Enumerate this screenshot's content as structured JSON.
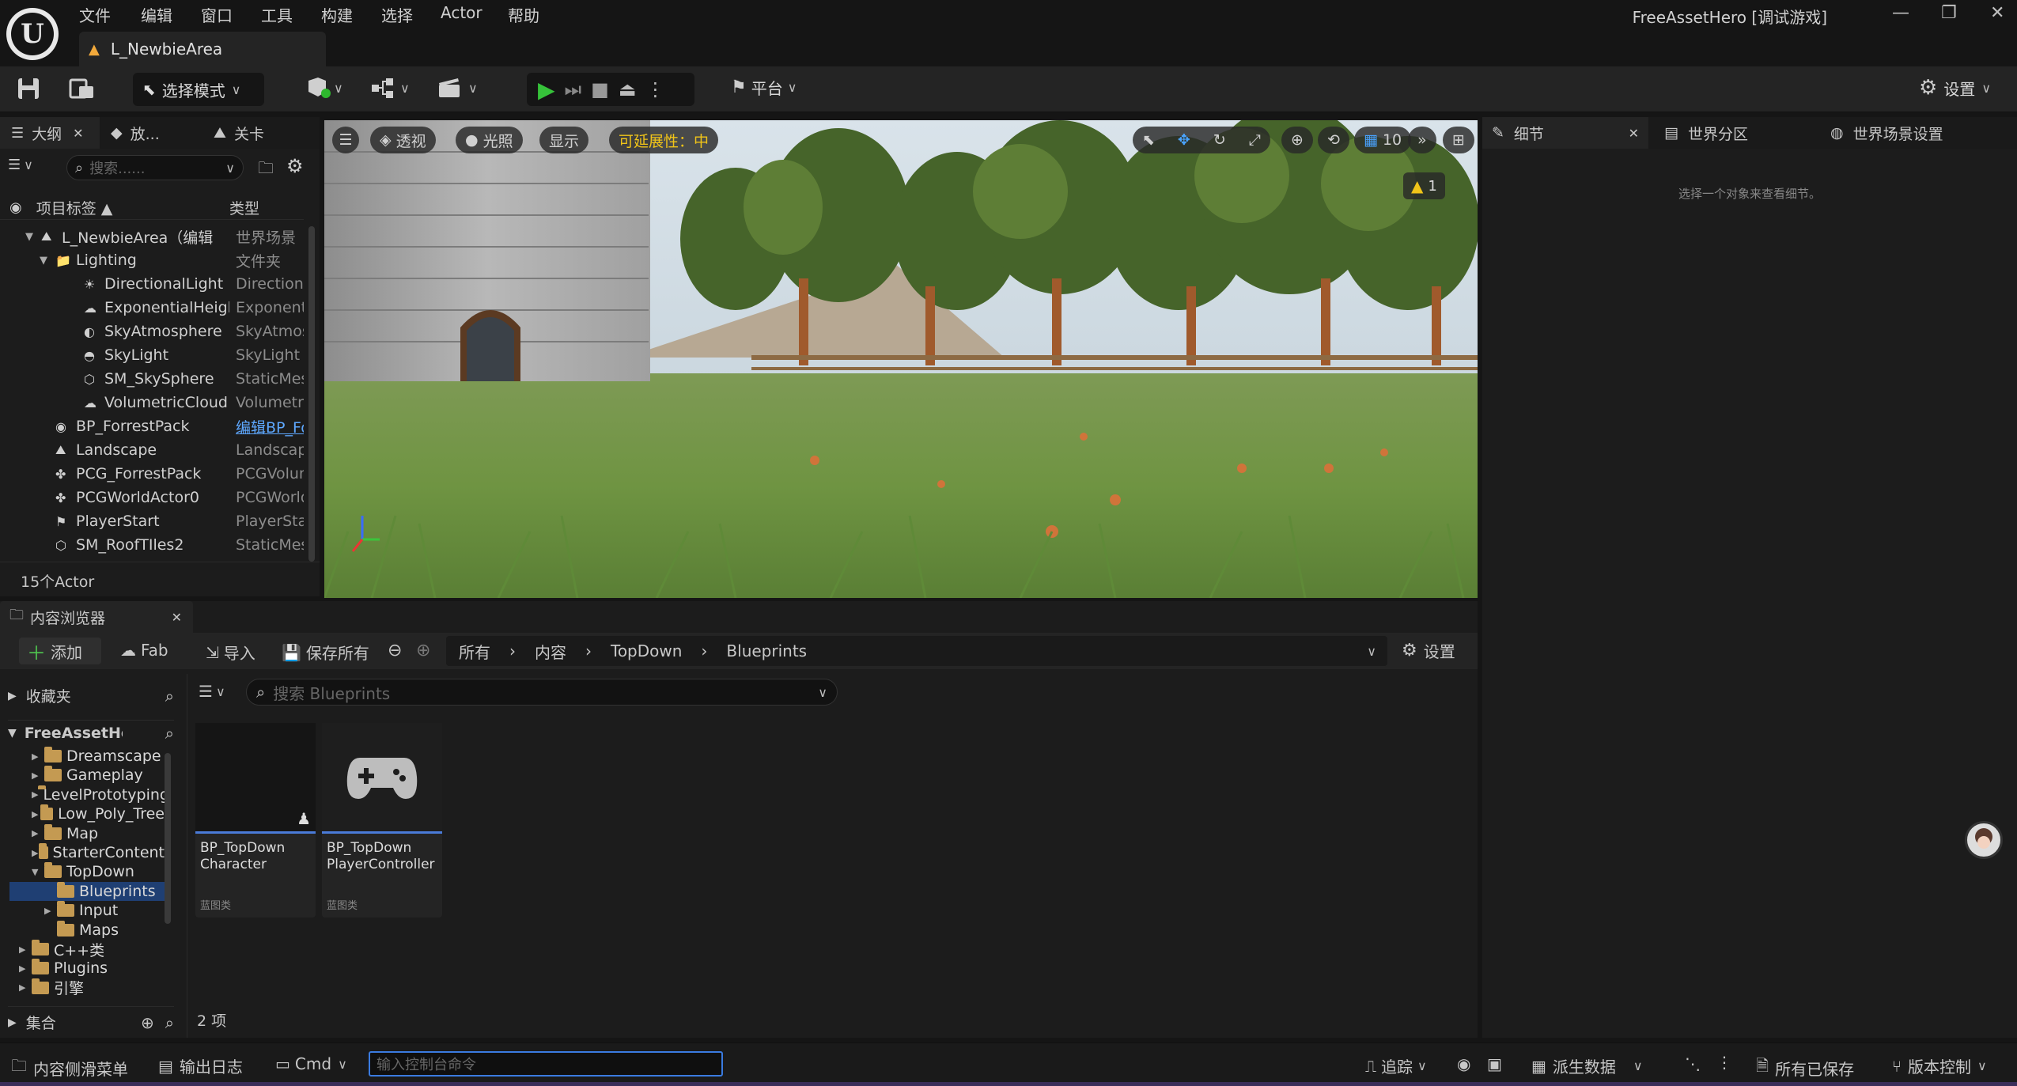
{
  "app": {
    "title": "FreeAssetHero [调试游戏]",
    "level_tab": "L_NewbieArea",
    "menu": [
      "文件",
      "编辑",
      "窗口",
      "工具",
      "构建",
      "选择",
      "Actor",
      "帮助"
    ]
  },
  "toolbar": {
    "select_mode": "选择模式",
    "platform": "平台",
    "settings": "设置"
  },
  "outliner": {
    "tabs": [
      "大纲",
      "放...",
      "关卡"
    ],
    "search_placeholder": "搜索......",
    "col_label": "项目标签 ▲",
    "col_type": "类型",
    "rows": [
      {
        "name": "L_NewbieArea（编辑",
        "type": "世界场景",
        "indent": 0,
        "icon": "level-icon",
        "expand": "open"
      },
      {
        "name": "Lighting",
        "type": "文件夹",
        "indent": 1,
        "icon": "folder-icon",
        "expand": "open"
      },
      {
        "name": "DirectionalLight",
        "type": "DirectionalLight",
        "indent": 2,
        "icon": "sun-icon",
        "expand": ""
      },
      {
        "name": "ExponentialHeightFog",
        "type": "ExponentialHeightFog",
        "indent": 2,
        "icon": "fog-icon",
        "expand": ""
      },
      {
        "name": "SkyAtmosphere",
        "type": "SkyAtmosphere",
        "indent": 2,
        "icon": "atmosphere-icon",
        "expand": ""
      },
      {
        "name": "SkyLight",
        "type": "SkyLight",
        "indent": 2,
        "icon": "skylight-icon",
        "expand": ""
      },
      {
        "name": "SM_SkySphere",
        "type": "StaticMeshActor",
        "indent": 2,
        "icon": "mesh-icon",
        "expand": ""
      },
      {
        "name": "VolumetricCloud",
        "type": "VolumetricCloud",
        "indent": 2,
        "icon": "cloud-icon",
        "expand": ""
      },
      {
        "name": "BP_ForrestPack",
        "type": "编辑BP_ForrestPack",
        "indent": 1,
        "icon": "blueprint-icon",
        "expand": "",
        "link": true
      },
      {
        "name": "Landscape",
        "type": "Landscape",
        "indent": 1,
        "icon": "landscape-icon",
        "expand": ""
      },
      {
        "name": "PCG_ForrestPack",
        "type": "PCGVolume",
        "indent": 1,
        "icon": "pcg-icon",
        "expand": ""
      },
      {
        "name": "PCGWorldActor0",
        "type": "PCGWorldActor",
        "indent": 1,
        "icon": "pcg-icon",
        "expand": ""
      },
      {
        "name": "PlayerStart",
        "type": "PlayerStart",
        "indent": 1,
        "icon": "flag-icon",
        "expand": ""
      },
      {
        "name": "SM_RoofTIles2",
        "type": "StaticMeshActor",
        "indent": 1,
        "icon": "mesh-icon",
        "expand": ""
      }
    ],
    "count": "15个Actor"
  },
  "viewport": {
    "perspective": "透视",
    "lit": "光照",
    "show": "显示",
    "scalability": "可延展性：中",
    "grid_size": "10",
    "warning_count": "1"
  },
  "content_browser": {
    "tab": "内容浏览器",
    "add": "添加",
    "fab": "Fab",
    "import": "导入",
    "save_all": "保存所有",
    "breadcrumb": [
      "所有",
      "内容",
      "TopDown",
      "Blueprints"
    ],
    "settings": "设置",
    "favorites": "收藏夹",
    "root": "FreeAssetHero",
    "search_placeholder": "搜索 Blueprints",
    "tree": [
      {
        "name": "Dreamscape",
        "indent": 1,
        "expand": "▶"
      },
      {
        "name": "Gameplay",
        "indent": 1,
        "expand": "▶"
      },
      {
        "name": "LevelPrototyping",
        "indent": 1,
        "expand": "▶"
      },
      {
        "name": "Low_Poly_Tree",
        "indent": 1,
        "expand": "▶"
      },
      {
        "name": "Map",
        "indent": 1,
        "expand": "▶"
      },
      {
        "name": "StarterContent",
        "indent": 1,
        "expand": "▶"
      },
      {
        "name": "TopDown",
        "indent": 1,
        "expand": "▼"
      },
      {
        "name": "Blueprints",
        "indent": 2,
        "expand": "",
        "selected": true
      },
      {
        "name": "Input",
        "indent": 2,
        "expand": "▶"
      },
      {
        "name": "Maps",
        "indent": 2,
        "expand": ""
      },
      {
        "name": "C++类",
        "indent": 0,
        "expand": "▶"
      },
      {
        "name": "Plugins",
        "indent": 0,
        "expand": "▶"
      },
      {
        "name": "引擎",
        "indent": 0,
        "expand": "▶"
      }
    ],
    "collections": "集合",
    "assets": [
      {
        "name": "BP_TopDown Character",
        "type": "蓝图类",
        "icon": "character-icon"
      },
      {
        "name": "BP_TopDown PlayerController",
        "type": "蓝图类",
        "icon": "gamepad-icon"
      }
    ],
    "item_count": "2 项"
  },
  "details": {
    "tabs": [
      "细节",
      "世界分区",
      "世界场景设置"
    ],
    "empty_text": "选择一个对象来查看细节。"
  },
  "statusbar": {
    "content_drawer": "内容侧滑菜单",
    "output_log": "输出日志",
    "cmd": "Cmd",
    "console_placeholder": "输入控制台命令",
    "trace": "追踪",
    "derived_data": "派生数据",
    "all_saved": "所有已保存",
    "source_control": "版本控制"
  }
}
